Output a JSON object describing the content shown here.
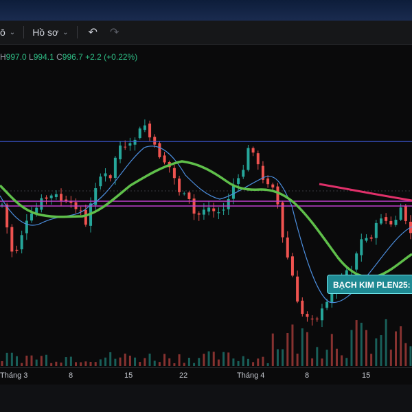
{
  "toolbar": {
    "left_fragment": "ô",
    "profile_label": "Hồ sơ",
    "undo_icon": "undo-arrow-icon",
    "redo_icon": "redo-arrow-icon"
  },
  "ohlc": {
    "h_label": "H",
    "h_value": "997.0",
    "l_label": "L",
    "l_value": "994.1",
    "c_label": "C",
    "c_value": "996.7",
    "change": "+2.2 (+0.22%)"
  },
  "colors": {
    "up": "#26a69a",
    "down": "#ef5350",
    "ma_fast": "#4c8fe0",
    "ma_slow": "#5fbf4a",
    "band": "#c03fd0",
    "level_line": "#3f5bd9",
    "pink_line": "#e0306a",
    "tag_bg": "#1f8a93"
  },
  "x_axis": {
    "labels": [
      "Tháng 3",
      "8",
      "15",
      "22",
      "Tháng 4",
      "8",
      "15"
    ]
  },
  "tag_label": "BẠCH KIM PLEN25:",
  "chart_data": {
    "type": "candlestick",
    "x_ticks": [
      "Tháng 3",
      "8",
      "15",
      "22",
      "Tháng 4",
      "8",
      "15"
    ],
    "series": [
      {
        "close": [
          300,
          304,
          312,
          305,
          315,
          322,
          318,
          328,
          335,
          340,
          332,
          342,
          350,
          355,
          345,
          338,
          330,
          322,
          315,
          308,
          300,
          296,
          302,
          310,
          320,
          330,
          352,
          365,
          372,
          380,
          378,
          366,
          350,
          340,
          325,
          310,
          300,
          292,
          285,
          288,
          294,
          300,
          308,
          312,
          318,
          322,
          318,
          310,
          305,
          312
        ]
      },
      {
        "volume": [
          8,
          10,
          6,
          12,
          9,
          14,
          7,
          11,
          15,
          9,
          12,
          8,
          10,
          13,
          9,
          11,
          14,
          10,
          12,
          9,
          11,
          13,
          15,
          12,
          10,
          14,
          20,
          24,
          30,
          28,
          26,
          35,
          40,
          45,
          50,
          48,
          42,
          38,
          36,
          34,
          30,
          32,
          28,
          26,
          24,
          22,
          20,
          18,
          16,
          14
        ]
      }
    ],
    "indicators": [
      "MA fast",
      "MA slow",
      "horizontal level",
      "horizontal band"
    ]
  }
}
